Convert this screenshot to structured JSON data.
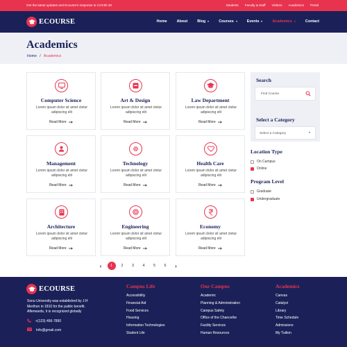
{
  "topbar": {
    "message": "Get the latest updates and Ecourse's response to COVID-33",
    "links": [
      "Students",
      "Faculty & Staff",
      "Visitors",
      "Academics",
      "Portal"
    ]
  },
  "brand": {
    "name": "ECOURSE",
    "accent": "#e8334f",
    "navy": "#1b2158"
  },
  "nav": {
    "items": [
      {
        "label": "Home",
        "caret": false,
        "active": false
      },
      {
        "label": "About",
        "caret": false,
        "active": false
      },
      {
        "label": "Blog",
        "caret": true,
        "active": false
      },
      {
        "label": "Courses",
        "caret": true,
        "active": false
      },
      {
        "label": "Events",
        "caret": true,
        "active": false
      },
      {
        "label": "Academics",
        "caret": true,
        "active": true
      },
      {
        "label": "Contact",
        "caret": false,
        "active": false
      }
    ]
  },
  "page": {
    "title": "Academics",
    "breadcrumb": {
      "home": "Home",
      "sep": "/",
      "current": "Academics"
    }
  },
  "cards": [
    {
      "title": "Computer Science",
      "icon": "monitor-icon",
      "desc": "Lorem ipsum dolor sit amet ctetur adipiscing elit",
      "link": "Read More"
    },
    {
      "title": "Art & Design",
      "icon": "palette-icon",
      "desc": "Lorem ipsum dolor sit amet ctetur adipiscing elit",
      "link": "Read More"
    },
    {
      "title": "Law Department",
      "icon": "graduation-cap-icon",
      "desc": "Lorem ipsum dolor sit amet ctetur adipiscing elit",
      "link": "Read More"
    },
    {
      "title": "Management",
      "icon": "user-icon",
      "desc": "Lorem ipsum dolor sit amet ctetur adipiscing elit",
      "link": "Read More"
    },
    {
      "title": "Technology",
      "icon": "gear-icon",
      "desc": "Lorem ipsum dolor sit amet ctetur adipiscing elit",
      "link": "Read More"
    },
    {
      "title": "Health Care",
      "icon": "heart-icon",
      "desc": "Lorem ipsum dolor sit amet ctetur adipiscing elit",
      "link": "Read More"
    },
    {
      "title": "Architecture",
      "icon": "building-icon",
      "desc": "Lorem ipsum dolor sit amet ctetur adipiscing elit",
      "link": "Read More"
    },
    {
      "title": "Engineering",
      "icon": "target-icon",
      "desc": "Lorem ipsum dolor sit amet ctetur adipiscing elit",
      "link": "Read More"
    },
    {
      "title": "Economy",
      "icon": "rupee-icon",
      "desc": "Lorem ipsum dolor sit amet ctetur adipiscing elit",
      "link": "Read More"
    }
  ],
  "pagination": {
    "prev": "‹",
    "next": "›",
    "pages": [
      "1",
      "2",
      "3",
      "4",
      "5",
      "6"
    ],
    "current": "1"
  },
  "sidebar": {
    "search": {
      "title": "Search",
      "placeholder": "Find Course"
    },
    "category": {
      "title": "Select a Category",
      "value": "Select a Category"
    },
    "location": {
      "title": "Location Type",
      "options": [
        {
          "label": "On Campus",
          "checked": false
        },
        {
          "label": "Online",
          "checked": true
        }
      ]
    },
    "level": {
      "title": "Program Level",
      "options": [
        {
          "label": "Graduate",
          "checked": false
        },
        {
          "label": "Undergraduate",
          "checked": true
        }
      ]
    }
  },
  "footer": {
    "about": "Sonu University was established by J.H Merthon in 1810 for the public benefit. Afterwards, it is recognized globally",
    "phone": "+(123) 456-7890",
    "email": "Info@gmail.com",
    "columns": [
      {
        "title": "Campus Life",
        "links": [
          "Accessibility",
          "Financial Aid",
          "Food Services",
          "Housing",
          "Information Technologies",
          "Student Life"
        ]
      },
      {
        "title": "Our Campus",
        "links": [
          "Academic",
          "Planning & Administration",
          "Campus Safety",
          "Office of the Chancellor",
          "Facility Services",
          "Human Resources"
        ]
      },
      {
        "title": "Academics",
        "links": [
          "Canvas",
          "Catalyst",
          "Library",
          "Time Schedule",
          "Admissions",
          "My Tuition"
        ]
      }
    ]
  }
}
